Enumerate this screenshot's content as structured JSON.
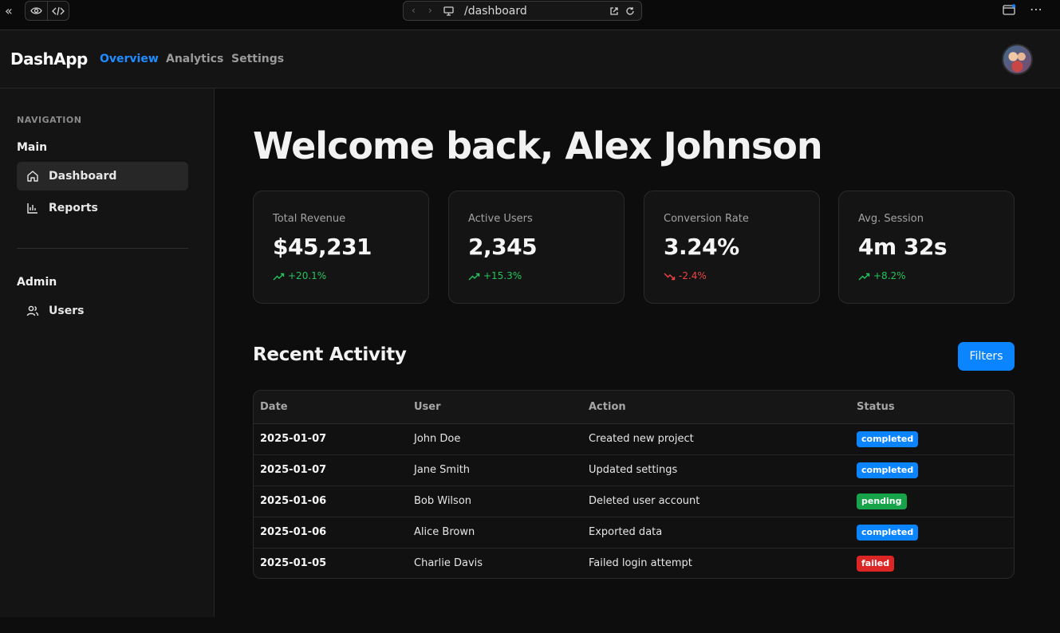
{
  "browser": {
    "url": "/dashboard"
  },
  "app": {
    "brand": "DashApp",
    "nav": [
      {
        "label": "Overview",
        "active": true
      },
      {
        "label": "Analytics",
        "active": false
      },
      {
        "label": "Settings",
        "active": false
      }
    ]
  },
  "sidebar": {
    "caption": "NAVIGATION",
    "groups": [
      {
        "label": "Main",
        "items": [
          {
            "label": "Dashboard",
            "icon": "home-icon",
            "active": true
          },
          {
            "label": "Reports",
            "icon": "bar-chart-icon",
            "active": false
          }
        ]
      },
      {
        "label": "Admin",
        "items": [
          {
            "label": "Users",
            "icon": "users-icon",
            "active": false
          }
        ]
      }
    ]
  },
  "main": {
    "welcome": "Welcome back, Alex Johnson",
    "stats": [
      {
        "title": "Total Revenue",
        "value": "$45,231",
        "delta": "+20.1%",
        "trend": "up"
      },
      {
        "title": "Active Users",
        "value": "2,345",
        "delta": "+15.3%",
        "trend": "up"
      },
      {
        "title": "Conversion Rate",
        "value": "3.24%",
        "delta": "-2.4%",
        "trend": "down"
      },
      {
        "title": "Avg. Session",
        "value": "4m 32s",
        "delta": "+8.2%",
        "trend": "up"
      }
    ],
    "activity": {
      "title": "Recent Activity",
      "filters_label": "Filters",
      "columns": [
        "Date",
        "User",
        "Action",
        "Status"
      ],
      "rows": [
        {
          "date": "2025-01-07",
          "user": "John Doe",
          "action": "Created new project",
          "status": "completed"
        },
        {
          "date": "2025-01-07",
          "user": "Jane Smith",
          "action": "Updated settings",
          "status": "completed"
        },
        {
          "date": "2025-01-06",
          "user": "Bob Wilson",
          "action": "Deleted user account",
          "status": "pending"
        },
        {
          "date": "2025-01-06",
          "user": "Alice Brown",
          "action": "Exported data",
          "status": "completed"
        },
        {
          "date": "2025-01-05",
          "user": "Charlie Davis",
          "action": "Failed login attempt",
          "status": "failed"
        }
      ]
    }
  },
  "colors": {
    "accent": "#0a84ff",
    "up": "#22c55e",
    "down": "#ef4444",
    "completed": "#0a84ff",
    "pending": "#16a34a",
    "failed": "#dc2626"
  }
}
